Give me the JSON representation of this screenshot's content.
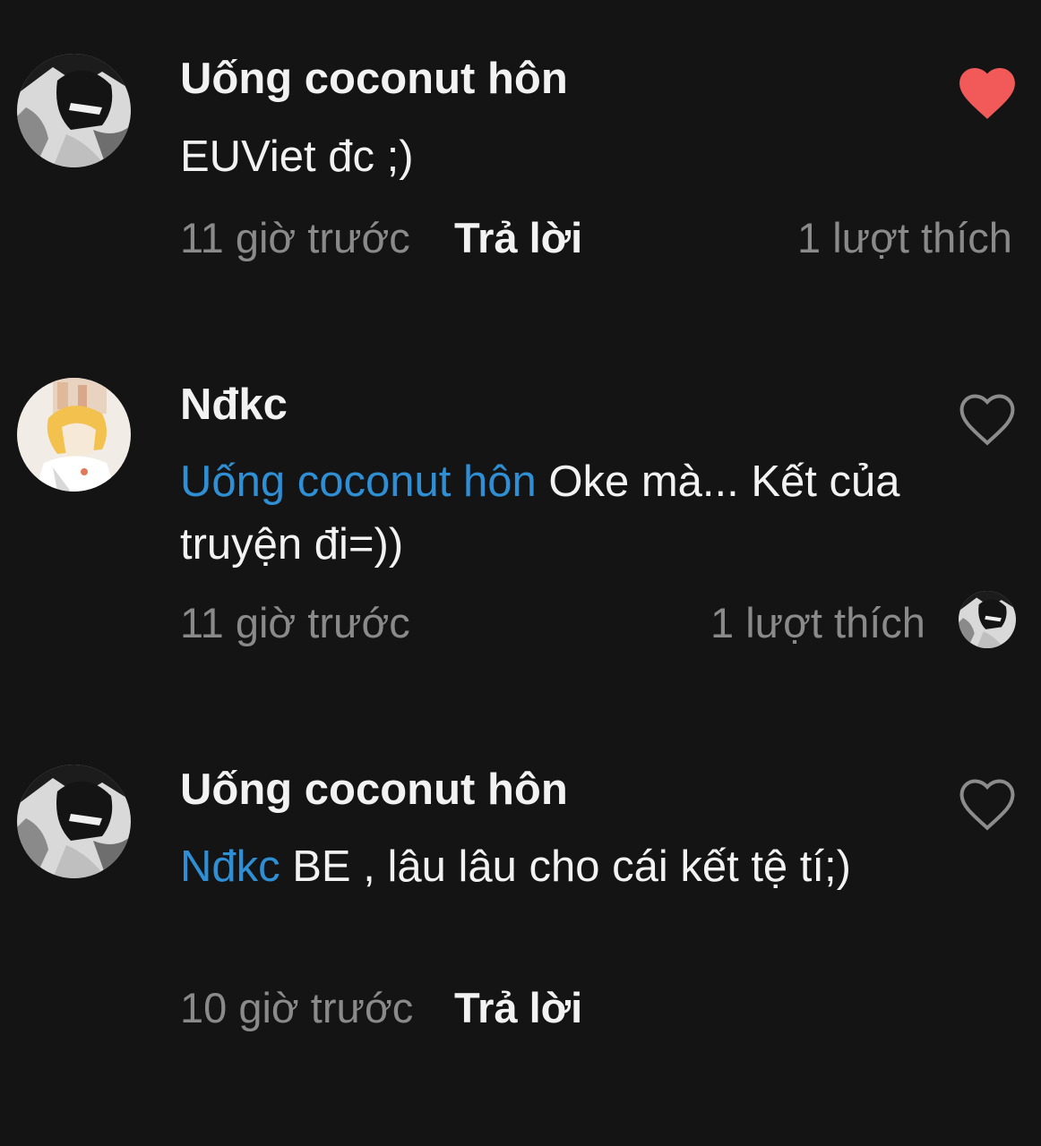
{
  "colors": {
    "background": "#141414",
    "text": "#f2f2f2",
    "muted": "#8a8a8a",
    "mention": "#2f8fd4",
    "heart_liked": "#f25a5a",
    "heart_outline": "#8c8c8c"
  },
  "comments": [
    {
      "username": "Uống coconut hôn",
      "avatar_icon": "avatar-manga-dark",
      "mention": "",
      "text": "EUViet đc ;)",
      "time": "11 giờ trước",
      "reply_label": "Trả lời",
      "likes": "1 lượt thích",
      "liked": true,
      "heart_icon": "heart-filled-icon"
    },
    {
      "username": "Nđkc",
      "avatar_icon": "avatar-blonde-character",
      "mention": "Uống coconut hôn",
      "text": " Oke mà... Kết của truyện đi=))",
      "time": "11 giờ trước",
      "reply_label": "",
      "likes": "1 lượt thích",
      "liked": false,
      "heart_icon": "heart-outline-icon",
      "liked_by_avatar_icon": "avatar-manga-dark"
    },
    {
      "username": "Uống coconut hôn",
      "avatar_icon": "avatar-manga-dark",
      "mention": "Nđkc",
      "text": " BE , lâu lâu cho cái kết tệ tí;)",
      "time": "10 giờ trước",
      "reply_label": "Trả lời",
      "likes": "",
      "liked": false,
      "heart_icon": "heart-outline-icon"
    }
  ]
}
